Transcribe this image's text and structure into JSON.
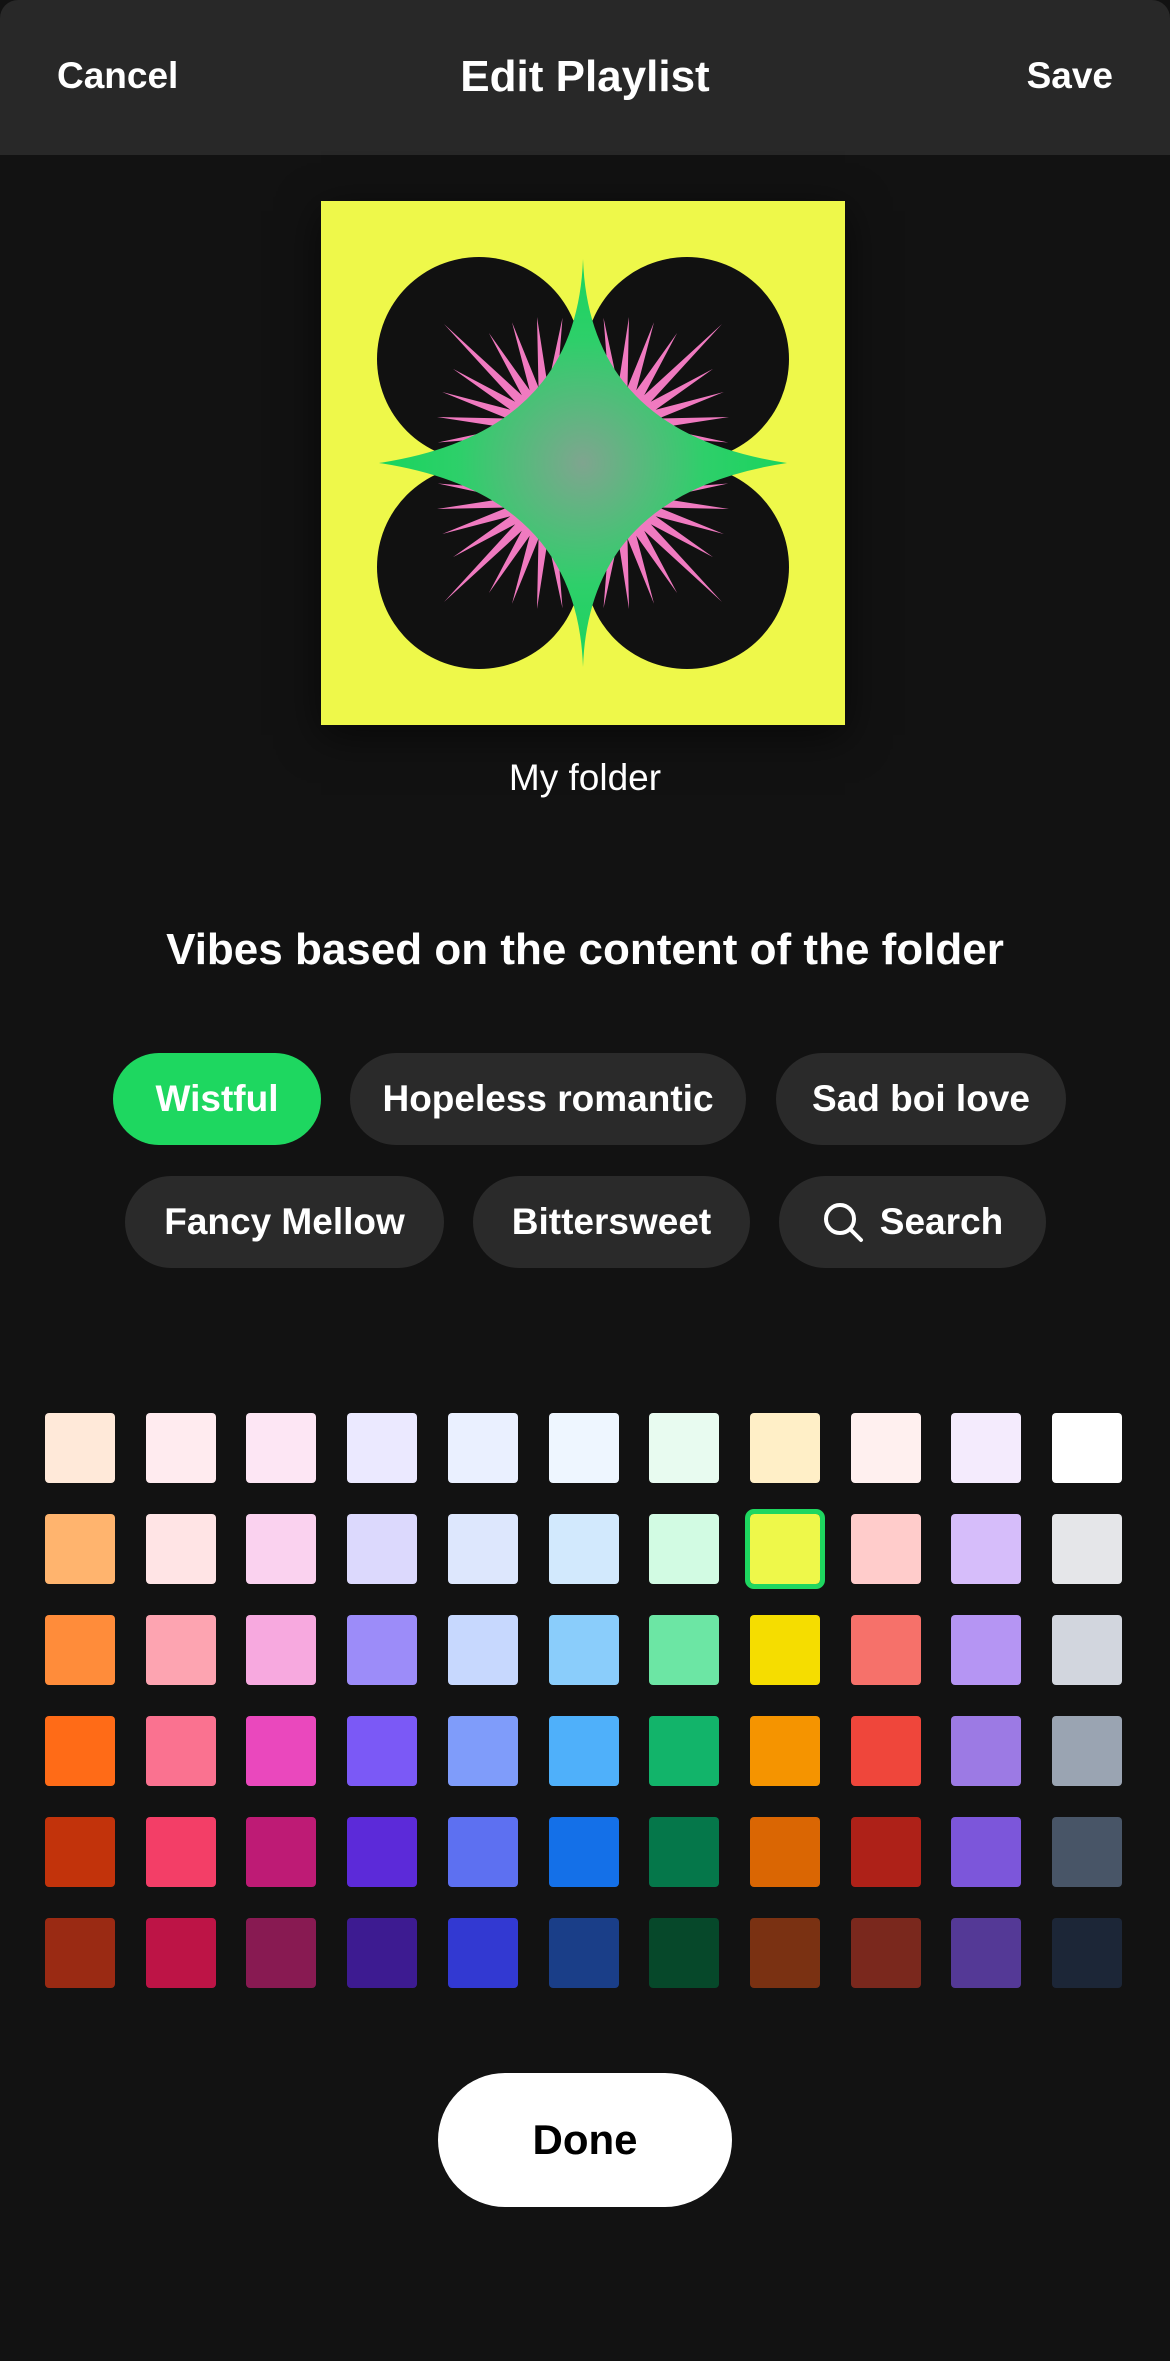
{
  "header": {
    "cancel_label": "Cancel",
    "title": "Edit Playlist",
    "save_label": "Save"
  },
  "cover": {
    "colors": {
      "background": "#eef84a",
      "circles": "#111111",
      "spikes": "#f07ac0",
      "diamond": "#1ed760"
    }
  },
  "folder_name": "My folder",
  "vibes": {
    "heading": "Vibes based on the content of the folder",
    "chips": [
      {
        "label": "Wistful",
        "active": true
      },
      {
        "label": "Hopeless romantic",
        "active": false
      },
      {
        "label": "Sad boi love",
        "active": false
      },
      {
        "label": "Fancy Mellow",
        "active": false
      },
      {
        "label": "Bittersweet",
        "active": false
      },
      {
        "label": "Search",
        "active": false,
        "icon": "search-icon"
      }
    ]
  },
  "palette": {
    "selected": "#eef84a",
    "rows": [
      [
        "#ffe9d9",
        "#ffebef",
        "#fde6f4",
        "#ebe9ff",
        "#eaf0ff",
        "#eef6ff",
        "#e8fbf0",
        "#ffefc7",
        "#fff0ef",
        "#f4ebfd",
        "#ffffff"
      ],
      [
        "#ffb46e",
        "#ffe4e5",
        "#fad2ef",
        "#dcd9fd",
        "#dde7fd",
        "#d2e9fd",
        "#d2fbe3",
        "#eef84a",
        "#ffcccb",
        "#d6bdfa",
        "#e5e6e9"
      ],
      [
        "#ff8c3a",
        "#fda4b1",
        "#f7a9df",
        "#9c8cf9",
        "#c7d8fe",
        "#8acdfb",
        "#6ce6a4",
        "#f5dd00",
        "#f6716a",
        "#b595f3",
        "#d2d6de"
      ],
      [
        "#ff6b17",
        "#fa7290",
        "#ea48bd",
        "#7b59f6",
        "#7f9cfa",
        "#4fb0fa",
        "#12b46a",
        "#f59400",
        "#ef463b",
        "#9c7ae4",
        "#9aa4b2"
      ],
      [
        "#c2330b",
        "#f33e67",
        "#be1b75",
        "#5c2ad9",
        "#5d70f1",
        "#1470e8",
        "#05774a",
        "#da6603",
        "#ae2118",
        "#7c56da",
        "#485567"
      ],
      [
        "#9a2a13",
        "#bd1446",
        "#881a52",
        "#3d1b91",
        "#3239d2",
        "#1a3e88",
        "#06482a",
        "#7a3112",
        "#7a281d",
        "#543996",
        "#1c2637"
      ]
    ]
  },
  "done_label": "Done"
}
